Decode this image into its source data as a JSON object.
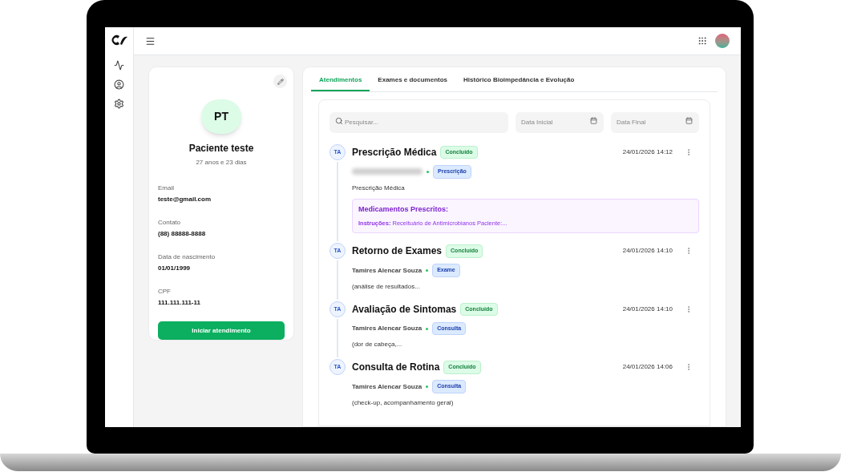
{
  "patient": {
    "initials": "PT",
    "name": "Paciente teste",
    "age": "27 anos e 23 dias",
    "fields": [
      {
        "label": "Email",
        "value": "teste@gmail.com"
      },
      {
        "label": "Contato",
        "value": "(88) 88888-8888"
      },
      {
        "label": "Data de nascimento",
        "value": "01/01/1999"
      },
      {
        "label": "CPF",
        "value": "111.111.111-11"
      }
    ],
    "action": "Iniciar atendimento"
  },
  "tabs": [
    {
      "label": "Atendimentos",
      "selected": true
    },
    {
      "label": "Exames e documentos",
      "selected": false
    },
    {
      "label": "Histórico Bioimpedância e Evolução",
      "selected": false
    }
  ],
  "search": {
    "placeholder": "Pesquisar..."
  },
  "date_fields": [
    {
      "placeholder": "Data Inicial"
    },
    {
      "placeholder": "Data Final"
    }
  ],
  "entries": [
    {
      "initials": "TA",
      "title": "Prescrição Médica",
      "status": "Concluído",
      "datetime": "24/01/2026 14:12",
      "author_blurred": true,
      "type": "Prescrição",
      "summary": "Prescrição Médica",
      "prescription": {
        "heading": "Medicamentos Prescritos:",
        "label": "Instruções:",
        "text": "Receituário de Antimicrobianos Paciente:..."
      }
    },
    {
      "initials": "TA",
      "title": "Retorno de Exames",
      "status": "Concluído",
      "datetime": "24/01/2026 14:10",
      "author": "Tamires Alencar Souza",
      "type": "Exame",
      "summary": "(análise de resultados..."
    },
    {
      "initials": "TA",
      "title": "Avaliação de Sintomas",
      "status": "Concluído",
      "datetime": "24/01/2026 14:10",
      "author": "Tamires Alencar Souza",
      "type": "Consulta",
      "summary": "(dor de cabeça,..."
    },
    {
      "initials": "TA",
      "title": "Consulta de Rotina",
      "status": "Concluído",
      "datetime": "24/01/2026 14:06",
      "author": "Tamires Alencar Souza",
      "type": "Consulta",
      "summary": "(check-up, acompanhamento geral)"
    }
  ]
}
